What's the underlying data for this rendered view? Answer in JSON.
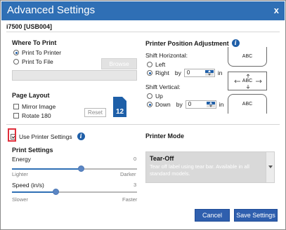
{
  "window": {
    "title": "Advanced Settings",
    "close_label": "x"
  },
  "device": "i7500 [USB004]",
  "where_to_print": {
    "heading": "Where To Print",
    "options": [
      "Print To Printer",
      "Print To File"
    ],
    "selected": "Print To Printer",
    "browse_label": "Browse",
    "path_value": ""
  },
  "page_layout": {
    "heading": "Page Layout",
    "mirror_label": "Mirror Image",
    "rotate_label": "Rotate 180",
    "reset_label": "Reset",
    "label_size_text": "12"
  },
  "position": {
    "heading": "Printer Position Adjustment",
    "horizontal_label": "Shift Horizontal:",
    "horizontal_options": [
      "Left",
      "Right"
    ],
    "horizontal_selected": "Right",
    "horizontal_by": "by",
    "horizontal_value": "0",
    "horizontal_unit": "in",
    "vertical_label": "Shift Vertical:",
    "vertical_options": [
      "Up",
      "Down"
    ],
    "vertical_selected": "Down",
    "vertical_by": "by",
    "vertical_value": "0",
    "vertical_unit": "in",
    "preview_top": "ABC",
    "preview_mid": "ABC",
    "preview_bottom": "ABC"
  },
  "use_printer_settings": {
    "label": "Use Printer Settings",
    "checked": true
  },
  "print_settings": {
    "heading": "Print Settings",
    "energy": {
      "label": "Energy",
      "value": "0",
      "min_label": "Lighter",
      "max_label": "Darker",
      "level": 0.55
    },
    "speed": {
      "label": "Speed (in/s)",
      "value": "3",
      "min_label": "Slower",
      "max_label": "Faster",
      "level": 0.35
    }
  },
  "printer_mode": {
    "heading": "Printer Mode",
    "selected_title": "Tear-Off",
    "selected_desc": "Tear off label using tear bar. Available in all standard models."
  },
  "buttons": {
    "cancel": "Cancel",
    "save": "Save Settings"
  },
  "colors": {
    "accent": "#2f6fb5",
    "highlight": "#e0303c"
  }
}
